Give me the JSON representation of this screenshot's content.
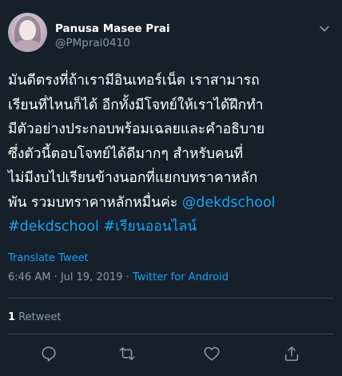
{
  "author": {
    "display_name": "Panusa Masee Prai",
    "handle": "@PMprai0410"
  },
  "tweet": {
    "lines": [
      [
        {
          "text": "มันดีตรงที่ถ้าเรามีอินเทอร์เน็ต เราสามารถ",
          "kind": "text"
        }
      ],
      [
        {
          "text": "เรียนที่ไหนก็ได้ อีกทั้งมีโจทย์ให้เราได้ฝึกทำ",
          "kind": "text"
        }
      ],
      [
        {
          "text": "มีตัวอย่างประกอบพร้อมเฉลยและคำอธิบาย",
          "kind": "text"
        }
      ],
      [
        {
          "text": "ซึ่งตัวนี้ตอบโจทย์ได้ดีมากๆ สำหรับคนที่",
          "kind": "text"
        }
      ],
      [
        {
          "text": "ไม่มีงบไปเรียนข้างนอกที่แยกบทราคาหลัก",
          "kind": "text"
        }
      ],
      [
        {
          "text": "พัน รวมบทราคาหลักหมื่นค่ะ ",
          "kind": "text"
        },
        {
          "text": "@dekdschool",
          "kind": "mention"
        }
      ],
      [
        {
          "text": "#dekdschool",
          "kind": "hashtag"
        },
        {
          "text": " ",
          "kind": "text"
        },
        {
          "text": "#เรียนออนไลน์",
          "kind": "hashtag"
        }
      ]
    ],
    "translate_label": "Translate Tweet",
    "time": "6:46 AM",
    "date": "Jul 19, 2019",
    "separator_1": " · ",
    "separator_2": " · ",
    "source": "Twitter for Android"
  },
  "stats": {
    "retweet_count": "1",
    "retweet_label": "Retweet"
  },
  "actions": [
    {
      "name": "reply-icon"
    },
    {
      "name": "retweet-icon"
    },
    {
      "name": "like-icon"
    },
    {
      "name": "share-icon"
    }
  ],
  "colors": {
    "background": "#15202b",
    "text": "#ffffff",
    "secondary": "#8899a6",
    "accent": "#1da1f2",
    "divider": "#38444d"
  }
}
